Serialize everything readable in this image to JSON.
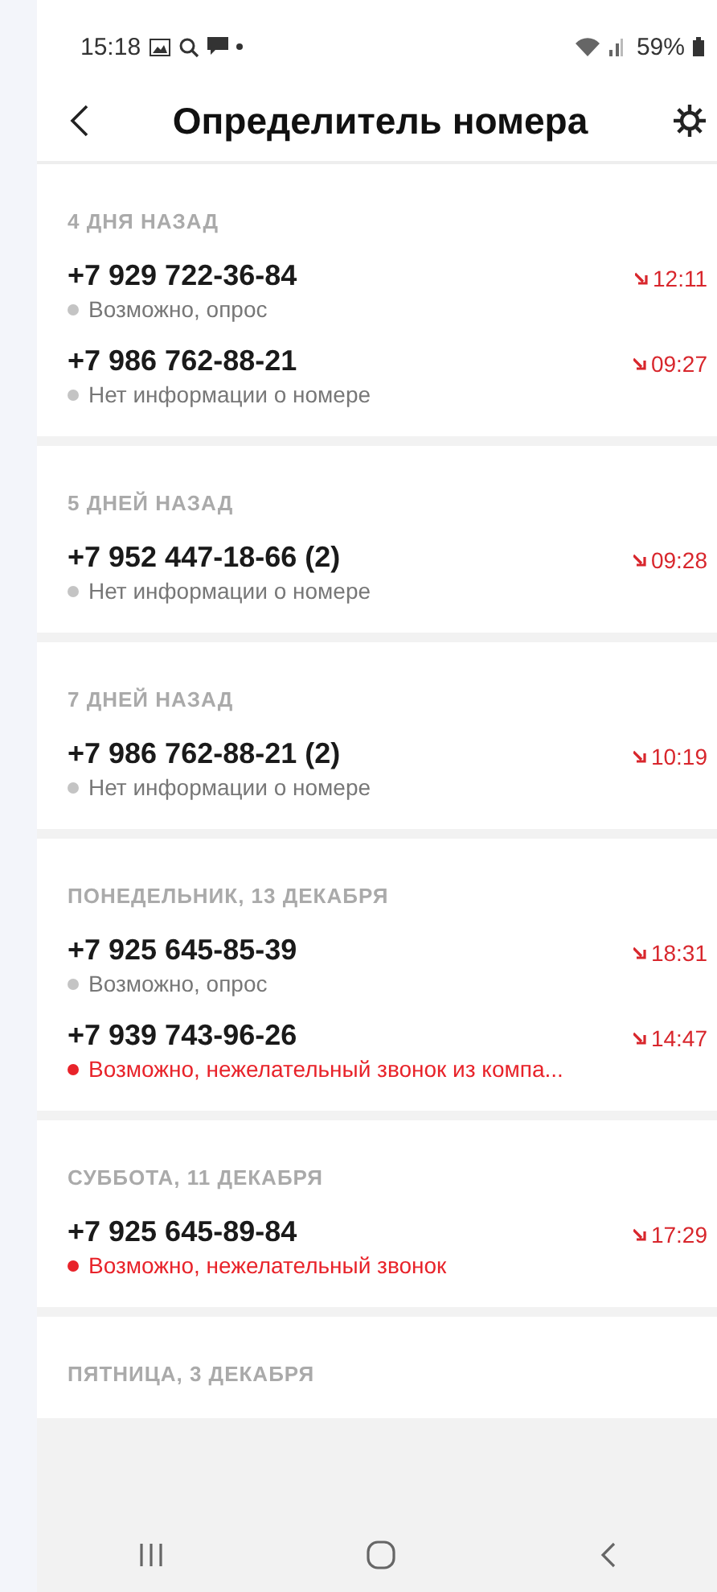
{
  "status_bar": {
    "time": "15:18",
    "battery": "59%"
  },
  "header": {
    "title": "Определитель номера"
  },
  "sections": [
    {
      "title": "4 ДНЯ НАЗАД",
      "calls": [
        {
          "number": "+7 929 722-36-84",
          "note": "Возможно, опрос",
          "warning": false,
          "time": "12:11"
        },
        {
          "number": "+7 986 762-88-21",
          "note": "Нет информации о номере",
          "warning": false,
          "time": "09:27"
        }
      ]
    },
    {
      "title": "5 ДНЕЙ НАЗАД",
      "calls": [
        {
          "number": "+7 952 447-18-66 (2)",
          "note": "Нет информации о номере",
          "warning": false,
          "time": "09:28"
        }
      ]
    },
    {
      "title": "7 ДНЕЙ НАЗАД",
      "calls": [
        {
          "number": "+7 986 762-88-21 (2)",
          "note": "Нет информации о номере",
          "warning": false,
          "time": "10:19"
        }
      ]
    },
    {
      "title": "ПОНЕДЕЛЬНИК, 13 ДЕКАБРЯ",
      "calls": [
        {
          "number": "+7 925 645-85-39",
          "note": "Возможно, опрос",
          "warning": false,
          "time": "18:31"
        },
        {
          "number": "+7 939 743-96-26",
          "note": "Возможно, нежелательный звонок из компа...",
          "warning": true,
          "time": "14:47"
        }
      ]
    },
    {
      "title": "СУББОТА, 11 ДЕКАБРЯ",
      "calls": [
        {
          "number": "+7 925 645-89-84",
          "note": "Возможно, нежелательный звонок",
          "warning": true,
          "time": "17:29"
        }
      ]
    },
    {
      "title": "ПЯТНИЦА, 3 ДЕКАБРЯ"
    }
  ]
}
